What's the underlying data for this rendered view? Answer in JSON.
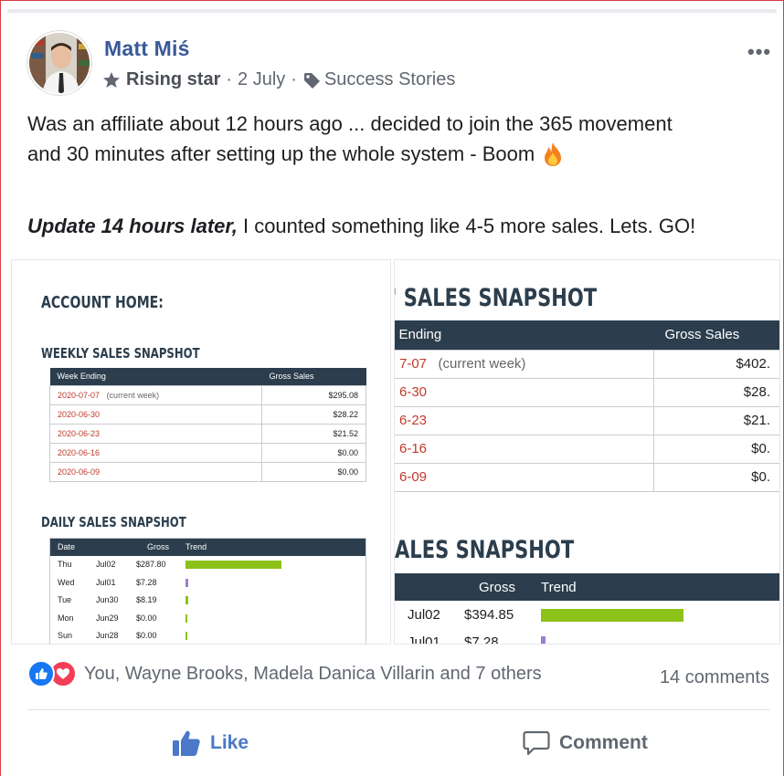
{
  "post": {
    "author": "Matt Miś",
    "badge": "Rising star",
    "date": "2 July",
    "topic": "Success Stories",
    "text_line1": "Was an affiliate about 12 hours ago ... decided to join the 365 movement",
    "text_line2": "and  30 minutes after setting up the whole system - Boom",
    "update_bold": "Update 14 hours later,",
    "update_rest": " I counted something like 4-5 more sales. Lets. GO!"
  },
  "screenshot_left": {
    "account_home": "ACCOUNT HOME:",
    "weekly_title": "WEEKLY SALES SNAPSHOT",
    "weekly_headers": [
      "Week Ending",
      "Gross Sales"
    ],
    "weekly_rows": [
      {
        "date": "2020-07-07",
        "note": "(current week)",
        "gross": "$295.08"
      },
      {
        "date": "2020-06-30",
        "note": "",
        "gross": "$28.22"
      },
      {
        "date": "2020-06-23",
        "note": "",
        "gross": "$21.52"
      },
      {
        "date": "2020-06-16",
        "note": "",
        "gross": "$0.00"
      },
      {
        "date": "2020-06-09",
        "note": "",
        "gross": "$0.00"
      }
    ],
    "daily_title": "DAILY SALES SNAPSHOT",
    "daily_headers": [
      "Date",
      "Gross",
      "Trend"
    ],
    "daily_rows": [
      {
        "day": "Thu",
        "date": "Jul02",
        "gross": "$287.80",
        "trend": 1.0,
        "color": "#8cc21a"
      },
      {
        "day": "Wed",
        "date": "Jul01",
        "gross": "$7.28",
        "trend": 0.03,
        "color": "#a07bd6"
      },
      {
        "day": "Tue",
        "date": "Jun30",
        "gross": "$8.19",
        "trend": 0.03,
        "color": "#8cc21a"
      },
      {
        "day": "Mon",
        "date": "Jun29",
        "gross": "$0.00",
        "trend": 0.01,
        "color": "#8cc21a"
      },
      {
        "day": "Sun",
        "date": "Jun28",
        "gross": "$0.00",
        "trend": 0.01,
        "color": "#8cc21a"
      }
    ]
  },
  "screenshot_right": {
    "weekly_title": "' SALES SNAPSHOT",
    "weekly_headers": [
      "Ending",
      "Gross Sales"
    ],
    "weekly_rows": [
      {
        "date": "7-07",
        "note": "(current week)",
        "gross": "$402."
      },
      {
        "date": "6-30",
        "note": "",
        "gross": "$28."
      },
      {
        "date": "6-23",
        "note": "",
        "gross": "$21."
      },
      {
        "date": "6-16",
        "note": "",
        "gross": "$0."
      },
      {
        "date": "6-09",
        "note": "",
        "gross": "$0."
      }
    ],
    "daily_title": "ALES SNAPSHOT",
    "daily_headers": [
      "Gross",
      "Trend"
    ],
    "daily_rows": [
      {
        "date": "Jul02",
        "gross": "$394.85",
        "trend": 1.0,
        "color": "#8cc21a"
      },
      {
        "date": "Jul01",
        "gross": "$7.28",
        "trend": 0.03,
        "color": "#a07bd6"
      }
    ]
  },
  "reactions": {
    "names": "You, Wayne Brooks, Madela Danica Villarin and 7 others",
    "comments": "14 comments",
    "icons": [
      "like-reaction-icon",
      "love-reaction-icon"
    ]
  },
  "actions": {
    "like_label": "Like",
    "comment_label": "Comment"
  },
  "colors": {
    "author": "#385898",
    "table_header": "#2c3e4d",
    "date_red": "#c0392b",
    "like_blue": "#4b78c8"
  }
}
